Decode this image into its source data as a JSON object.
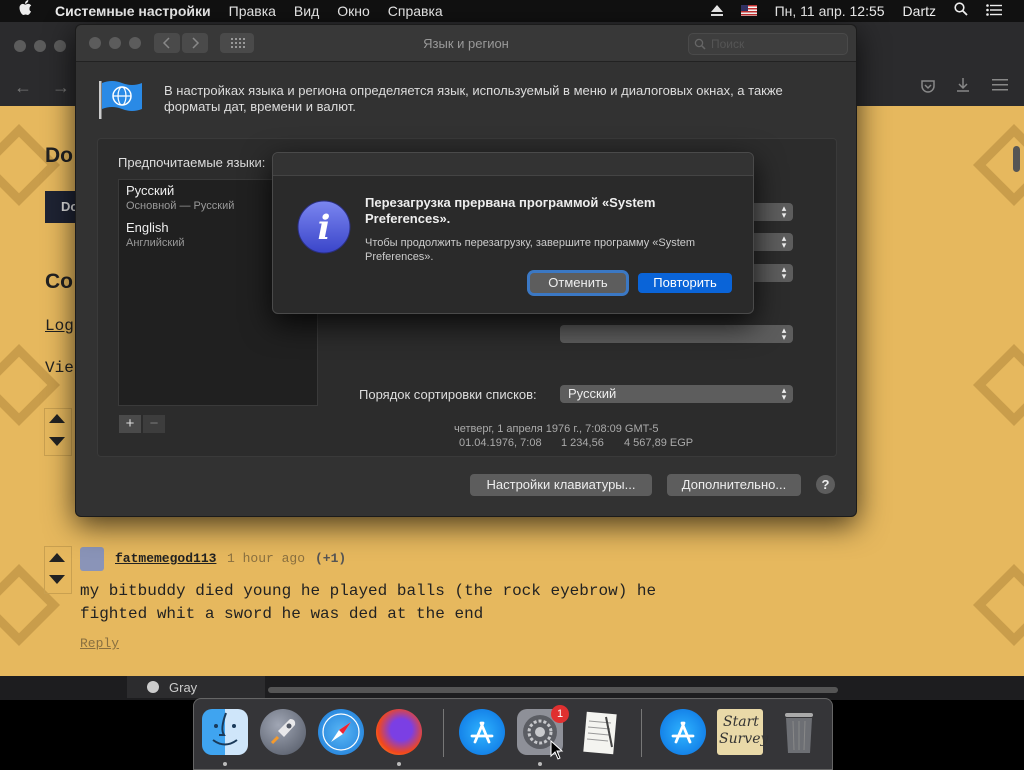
{
  "menubar": {
    "apple": "",
    "app_name": "Системные настройки",
    "items": [
      "Правка",
      "Вид",
      "Окно",
      "Справка"
    ],
    "datetime": "Пн, 11 апр. 12:55",
    "user": "Dartz"
  },
  "browser": {
    "heading_partial": "Do",
    "tag_partial": "Do",
    "section_partial": "Co",
    "link_partial": "Log",
    "view_partial": "Vie",
    "comment": {
      "username": "fatmemegod113",
      "time": "1 hour ago",
      "score": "(+1)",
      "text_line1": "my bitbuddy died young he played balls (the rock eyebrow) he",
      "text_line2": "fighted whit a sword he was ded at the end",
      "reply": "Reply"
    },
    "bottom_label": "Gray"
  },
  "prefs": {
    "title": "Язык и регион",
    "search_placeholder": "Поиск",
    "description": "В настройках языка и региона определяется язык, используемый в меню и диалоговых окнах, а также форматы дат, времени и валют.",
    "preferred_languages_label": "Предпочитаемые языки:",
    "languages": [
      {
        "name": "Русский",
        "sub": "Основной — Русский"
      },
      {
        "name": "English",
        "sub": "Английский"
      }
    ],
    "add": "+",
    "remove": "−",
    "sort_label": "Порядок сортировки списков:",
    "sort_value": "Русский",
    "sample_line1": "четверг, 1 апреля 1976 г., 7:08:09 GMT-5",
    "sample_line2_date": "01.04.1976, 7:08",
    "sample_line2_num": "1 234,56",
    "sample_line2_cur": "4 567,89 EGP",
    "keyboard_button": "Настройки клавиатуры...",
    "advanced_button": "Дополнительно...",
    "help": "?"
  },
  "alert": {
    "title": "Перезагрузка прервана программой «System Preferences».",
    "message": "Чтобы продолжить перезагрузку, завершите программу «System Preferences».",
    "cancel": "Отменить",
    "retry": "Повторить"
  },
  "dock": {
    "badge": "1",
    "items": [
      "finder-icon",
      "launchpad-icon",
      "safari-icon",
      "firefox-icon",
      "app-store-icon",
      "system-preferences-icon",
      "textedit-icon",
      "app-store-icon-2",
      "start-survey-icon",
      "trash-icon"
    ],
    "survey_label": "Start Survey"
  },
  "colors": {
    "accent": "#0a64d8",
    "browser_bg": "#e6b85e",
    "prefs_bg": "#323232"
  }
}
